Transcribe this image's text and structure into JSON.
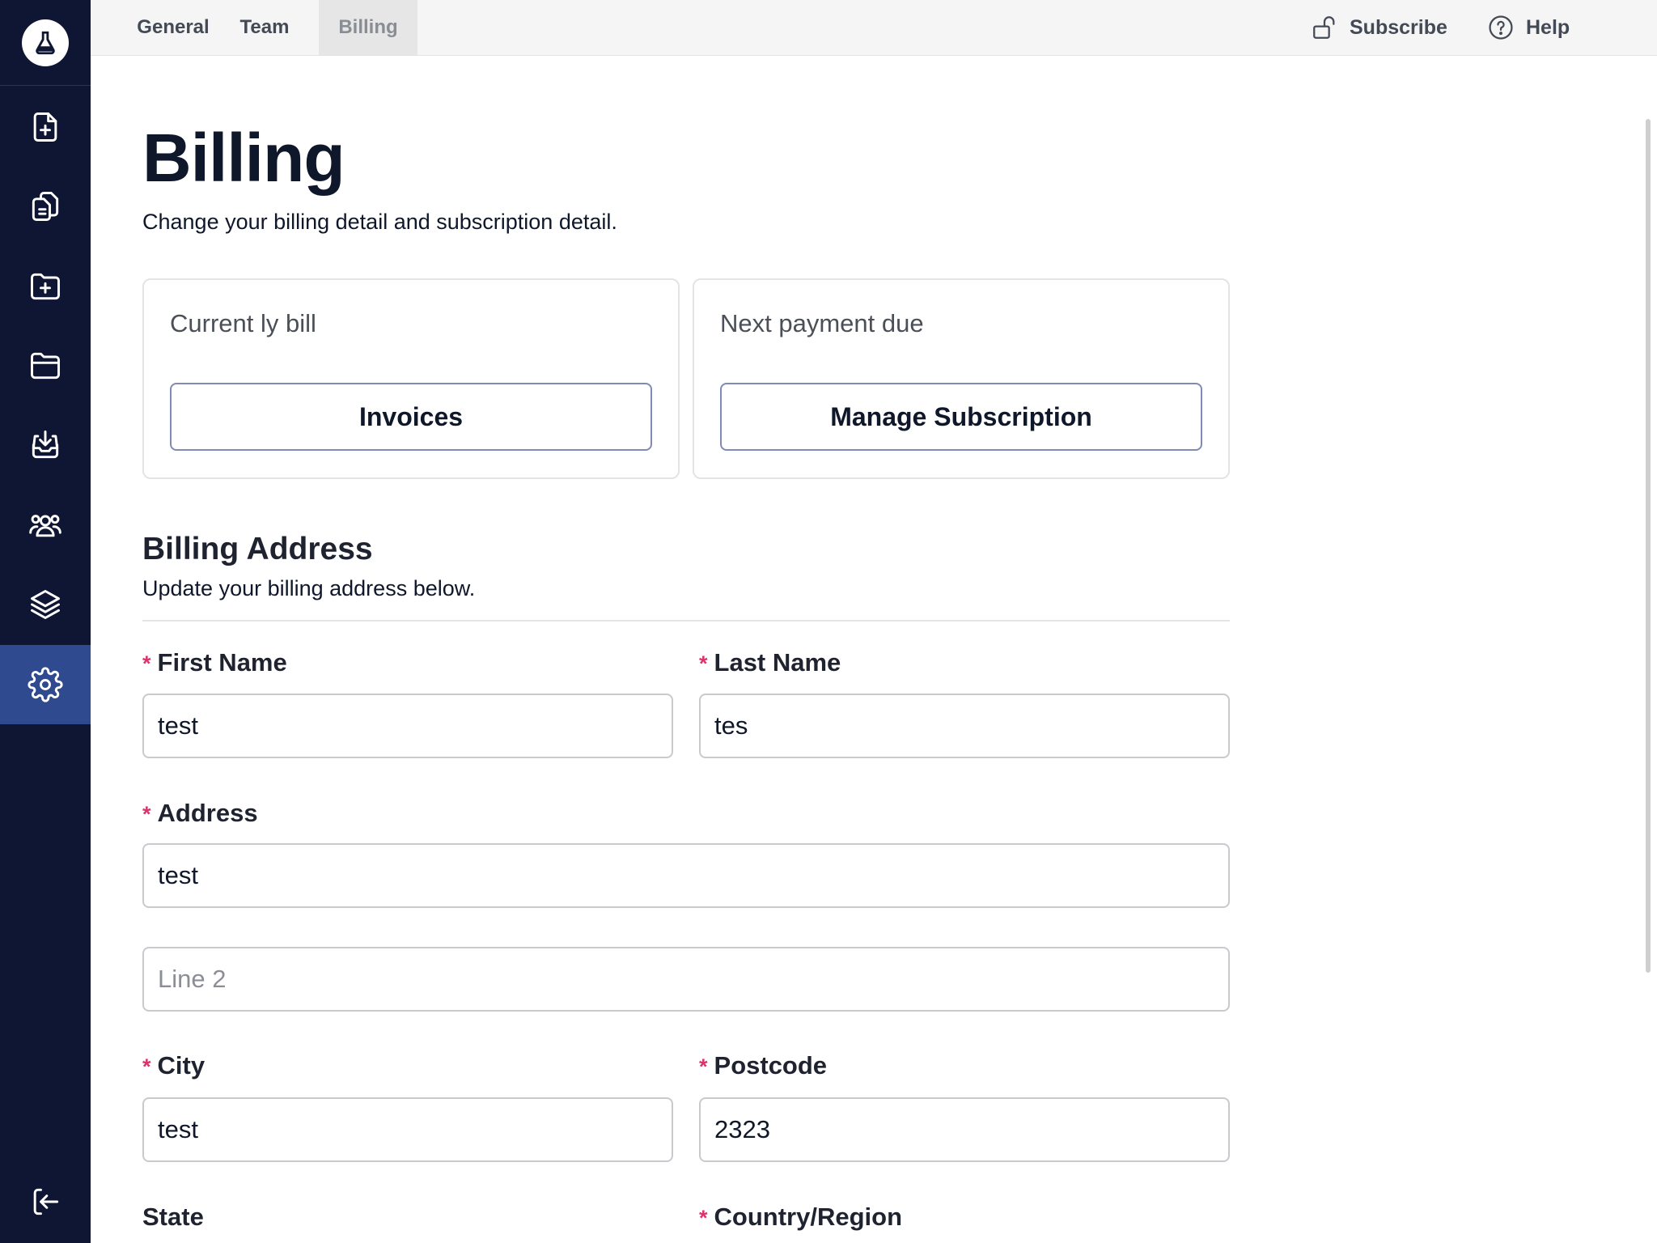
{
  "tabs": [
    {
      "label": "General"
    },
    {
      "label": "Team"
    },
    {
      "label": "Billing",
      "active": true
    }
  ],
  "top_actions": {
    "subscribe": "Subscribe",
    "help": "Help"
  },
  "sidebar": {
    "items": [
      {
        "icon": "file-plus-icon"
      },
      {
        "icon": "documents-icon"
      },
      {
        "icon": "folder-plus-icon"
      },
      {
        "icon": "folder-icon"
      },
      {
        "icon": "inbox-download-icon"
      },
      {
        "icon": "users-icon"
      },
      {
        "icon": "layers-icon"
      },
      {
        "icon": "gear-icon",
        "active": true
      }
    ],
    "bottom_icon": "logout-icon"
  },
  "page": {
    "title": "Billing",
    "subtitle": "Change your billing detail and subscription detail."
  },
  "cards": {
    "current_bill_label": "Current ly bill",
    "invoices_button": "Invoices",
    "next_payment_label": "Next payment due",
    "manage_subscription_button": "Manage Subscription"
  },
  "billing_address": {
    "title": "Billing Address",
    "subtitle": "Update your billing address below.",
    "required_mark": "*",
    "first_name": {
      "label": "First Name",
      "value": "test"
    },
    "last_name": {
      "label": "Last Name",
      "value": "tes"
    },
    "address": {
      "label": "Address",
      "value": "test"
    },
    "line2": {
      "placeholder": "Line 2",
      "value": ""
    },
    "city": {
      "label": "City",
      "value": "test"
    },
    "postcode": {
      "label": "Postcode",
      "value": "2323"
    },
    "state": {
      "label": "State"
    },
    "country": {
      "label": "Country/Region"
    }
  },
  "colors": {
    "sidebar_bg": "#0f1634",
    "sidebar_active": "#2f4a8f",
    "required": "#e0316a",
    "button_border": "#7f8bb5"
  }
}
